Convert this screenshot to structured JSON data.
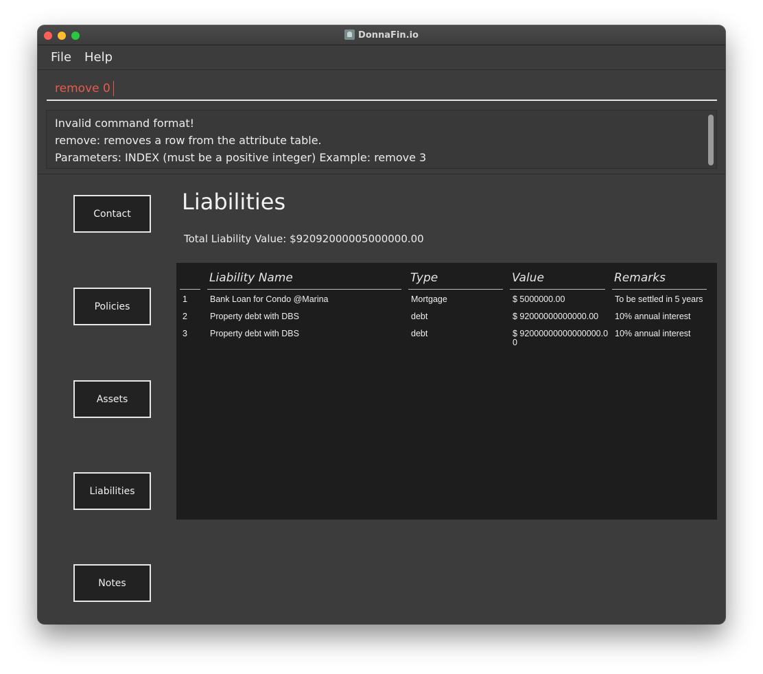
{
  "window": {
    "title": "DonnaFin.io",
    "app_icon": "donnafin-app-icon"
  },
  "menu": {
    "file": "File",
    "help": "Help"
  },
  "command": {
    "value": "remove 0",
    "text_color": "#e85b4e"
  },
  "result": {
    "line1": "Invalid command format!",
    "line2": "remove: removes a row from the attribute table.",
    "line3": "Parameters: INDEX (must be a positive integer) Example: remove 3"
  },
  "nav": {
    "contact": "Contact",
    "policies": "Policies",
    "assets": "Assets",
    "liabilities": "Liabilities",
    "notes": "Notes"
  },
  "section": {
    "title": "Liabilities",
    "total": "Total Liability Value: $92092000005000000.00"
  },
  "table": {
    "headers": {
      "index": "",
      "name": "Liability Name",
      "type": "Type",
      "value": "Value",
      "remarks": "Remarks"
    },
    "rows": [
      {
        "index": "1",
        "name": "Bank Loan for Condo @Marina",
        "type": "Mortgage",
        "value": "$ 5000000.00",
        "remarks": "To be settled in 5 years"
      },
      {
        "index": "2",
        "name": "Property debt with DBS",
        "type": "debt",
        "value": "$ 92000000000000.00",
        "remarks": "10% annual interest"
      },
      {
        "index": "3",
        "name": "Property debt with DBS",
        "type": "debt",
        "value": "$ 92000000000000000.00",
        "remarks": "10% annual interest"
      }
    ]
  }
}
